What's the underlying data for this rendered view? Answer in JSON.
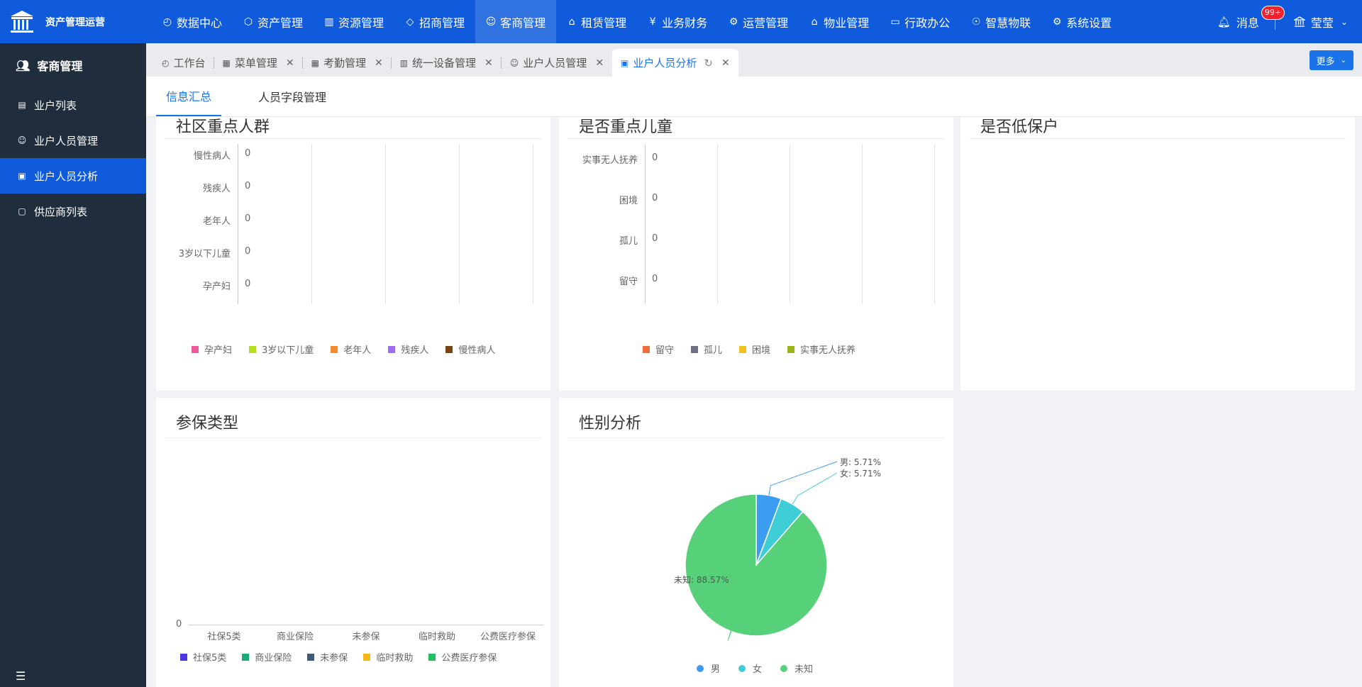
{
  "app": {
    "title": "资产管理运营"
  },
  "topnav": {
    "items": [
      {
        "label": "数据中心",
        "icon": "dashboard-icon"
      },
      {
        "label": "资产管理",
        "icon": "cube-icon"
      },
      {
        "label": "资源管理",
        "icon": "building-icon"
      },
      {
        "label": "招商管理",
        "icon": "tag-icon"
      },
      {
        "label": "客商管理",
        "icon": "users-icon"
      },
      {
        "label": "租赁管理",
        "icon": "home-icon"
      },
      {
        "label": "业务财务",
        "icon": "yen-icon"
      },
      {
        "label": "运营管理",
        "icon": "robot-icon"
      },
      {
        "label": "物业管理",
        "icon": "house-icon"
      },
      {
        "label": "行政办公",
        "icon": "monitor-icon"
      },
      {
        "label": "智慧物联",
        "icon": "iot-icon"
      },
      {
        "label": "系统设置",
        "icon": "gear-icon"
      }
    ],
    "active_index": 4,
    "messages_label": "消息",
    "messages_badge": "99+",
    "user_name": "莹莹"
  },
  "sidebar": {
    "title": "客商管理",
    "items": [
      {
        "label": "业户列表",
        "icon": "document-icon"
      },
      {
        "label": "业户人员管理",
        "icon": "user-icon"
      },
      {
        "label": "业户人员分析",
        "icon": "chart-icon"
      },
      {
        "label": "供应商列表",
        "icon": "contact-icon"
      }
    ],
    "active_index": 2,
    "collapse_icon": "menu-fold-icon"
  },
  "tabs": {
    "items": [
      {
        "label": "工作台",
        "icon": "dashboard-icon",
        "closable": false
      },
      {
        "label": "菜单管理",
        "icon": "grid-icon",
        "closable": true
      },
      {
        "label": "考勤管理",
        "icon": "calendar-icon",
        "closable": true
      },
      {
        "label": "统一设备管理",
        "icon": "device-icon",
        "closable": true
      },
      {
        "label": "业户人员管理",
        "icon": "user-icon",
        "closable": true
      },
      {
        "label": "业户人员分析",
        "icon": "chart-icon",
        "closable": true
      }
    ],
    "active_index": 5,
    "more_label": "更多"
  },
  "subtabs": {
    "items": [
      "信息汇总",
      "人员字段管理"
    ],
    "active_index": 0
  },
  "colors": {
    "primary": "#0f5bdc",
    "accent": "#1a73e8",
    "sidebar_bg": "#1f2d3d"
  },
  "chart_data": [
    {
      "type": "bar",
      "orientation": "horizontal",
      "title": "社区重点人群",
      "categories": [
        "慢性病人",
        "残疾人",
        "老年人",
        "3岁以下儿童",
        "孕产妇"
      ],
      "series": [
        {
          "name": "孕产妇",
          "color": "#ee5a9e",
          "values": [
            0,
            0,
            0,
            0,
            0
          ]
        },
        {
          "name": "3岁以下儿童",
          "color": "#b3e01a",
          "values": [
            0,
            0,
            0,
            0,
            0
          ]
        },
        {
          "name": "老年人",
          "color": "#f58a2e",
          "values": [
            0,
            0,
            0,
            0,
            0
          ]
        },
        {
          "name": "残疾人",
          "color": "#9e6cf2",
          "values": [
            0,
            0,
            0,
            0,
            0
          ]
        },
        {
          "name": "慢性病人",
          "color": "#7b4310",
          "values": [
            0,
            0,
            0,
            0,
            0
          ]
        }
      ],
      "data_labels": [
        "0",
        "0",
        "0",
        "0",
        "0"
      ],
      "legend": "bottom",
      "grid": true
    },
    {
      "type": "bar",
      "orientation": "horizontal",
      "title": "是否重点儿童",
      "categories": [
        "实事无人抚养",
        "困境",
        "孤儿",
        "留守"
      ],
      "series": [
        {
          "name": "留守",
          "color": "#f26b3a",
          "values": [
            0,
            0,
            0,
            0
          ]
        },
        {
          "name": "孤儿",
          "color": "#6e7185",
          "values": [
            0,
            0,
            0,
            0
          ]
        },
        {
          "name": "困境",
          "color": "#f5c020",
          "values": [
            0,
            0,
            0,
            0
          ]
        },
        {
          "name": "实事无人抚养",
          "color": "#99b51a",
          "values": [
            0,
            0,
            0,
            0
          ]
        }
      ],
      "data_labels": [
        "0",
        "0",
        "0",
        "0"
      ],
      "legend": "bottom",
      "grid": true
    },
    {
      "type": "pie",
      "title": "是否低保户",
      "series": []
    },
    {
      "type": "bar",
      "title": "参保类型",
      "categories": [
        "社保5类",
        "商业保险",
        "未参保",
        "临时救助",
        "公费医疗参保"
      ],
      "series": [
        {
          "name": "社保5类",
          "color": "#4a3ae0",
          "values": [
            0,
            0,
            0,
            0,
            0
          ]
        },
        {
          "name": "商业保险",
          "color": "#1aaa7c",
          "values": [
            0,
            0,
            0,
            0,
            0
          ]
        },
        {
          "name": "未参保",
          "color": "#3e5a78",
          "values": [
            0,
            0,
            0,
            0,
            0
          ]
        },
        {
          "name": "临时救助",
          "color": "#f5b814",
          "values": [
            0,
            0,
            0,
            0,
            0
          ]
        },
        {
          "name": "公费医疗参保",
          "color": "#22c05e",
          "values": [
            0,
            0,
            0,
            0,
            0
          ]
        }
      ],
      "y_tick": "0",
      "legend": "bottom"
    },
    {
      "type": "pie",
      "title": "性别分析",
      "series": [
        {
          "name": "男",
          "value": 5.71,
          "label": "男: 5.71%",
          "color": "#3b9cf2"
        },
        {
          "name": "女",
          "value": 5.71,
          "label": "女: 5.71%",
          "color": "#3ecdd6"
        },
        {
          "name": "未知",
          "value": 88.57,
          "label": "未知: 88.57%",
          "color": "#57d07a"
        }
      ],
      "legend": "bottom"
    }
  ]
}
